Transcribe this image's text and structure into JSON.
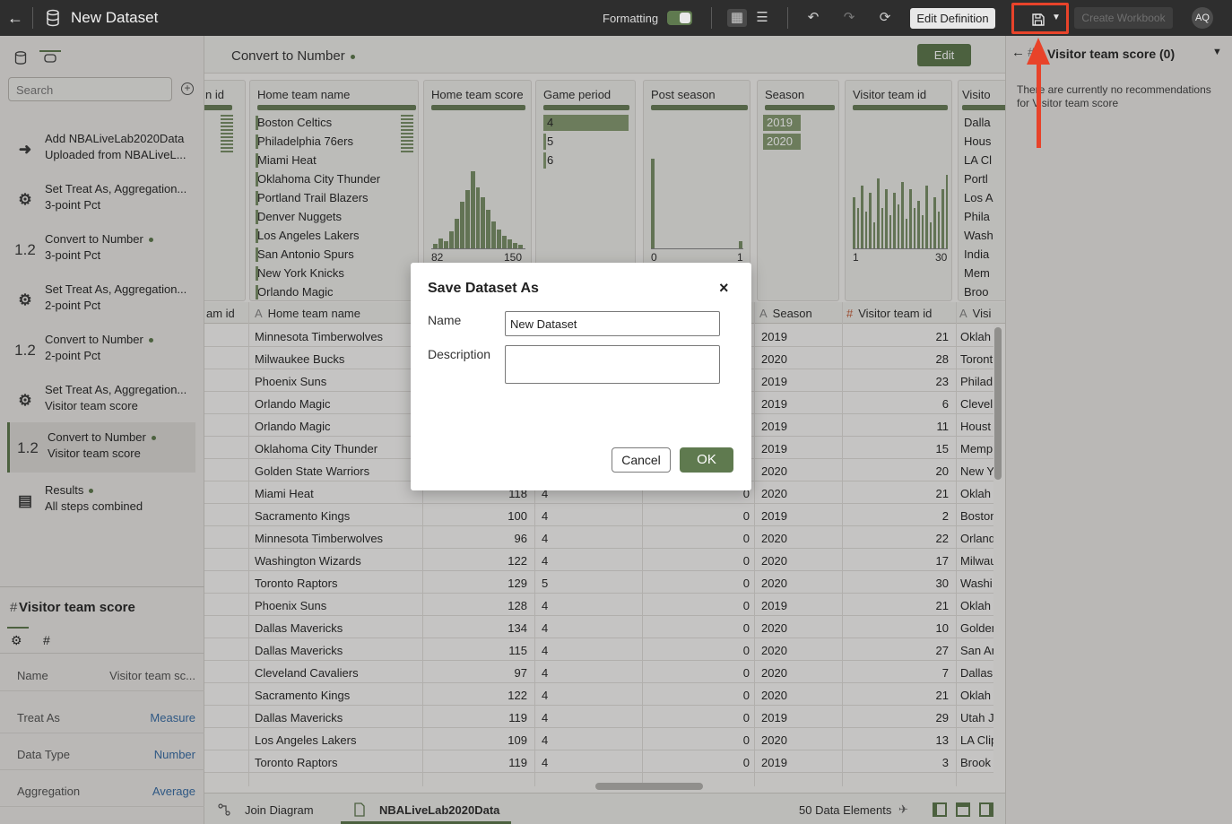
{
  "topbar": {
    "title": "New Dataset",
    "formatting_label": "Formatting",
    "edit_definition": "Edit Definition",
    "create_workbook": "Create Workbook",
    "avatar": "AQ"
  },
  "left_panel": {
    "search_placeholder": "Search",
    "steps": [
      {
        "icon": "arrow-into-icon",
        "line1": "Add NBALiveLab2020Data",
        "line2": "Uploaded from NBALiveL..."
      },
      {
        "icon": "gear-icon",
        "line1": "Set Treat As, Aggregation...",
        "line2": "3-point Pct"
      },
      {
        "icon": "number-icon",
        "icon_text": "1.2",
        "line1": "Convert to Number",
        "line2": "3-point Pct"
      },
      {
        "icon": "gear-icon",
        "line1": "Set Treat As, Aggregation...",
        "line2": "2-point Pct"
      },
      {
        "icon": "number-icon",
        "icon_text": "1.2",
        "line1": "Convert to Number",
        "line2": "2-point Pct"
      },
      {
        "icon": "gear-icon",
        "line1": "Set Treat As, Aggregation...",
        "line2": "Visitor team score"
      },
      {
        "icon": "number-icon",
        "icon_text": "1.2",
        "line1": "Convert to Number",
        "line2": "Visitor team score"
      },
      {
        "icon": "results-icon",
        "line1": "Results",
        "line2": "All steps combined"
      }
    ],
    "column_properties": {
      "hash": "#",
      "title": "Visitor team score",
      "tab_hash": "#",
      "rows": [
        {
          "key": "Name",
          "value": "Visitor team sc..."
        },
        {
          "key": "Treat As",
          "value": "Measure"
        },
        {
          "key": "Data Type",
          "value": "Number"
        },
        {
          "key": "Aggregation",
          "value": "Average"
        }
      ]
    }
  },
  "center": {
    "step_title": "Convert to Number",
    "edit_button": "Edit",
    "cards": {
      "home_team_id": {
        "header": "n id"
      },
      "home_team_name": {
        "header": "Home team name",
        "items": [
          "Boston Celtics",
          "Philadelphia 76ers",
          "Miami Heat",
          "Oklahoma City Thunder",
          "Portland Trail Blazers",
          "Denver Nuggets",
          "Los Angeles Lakers",
          "San Antonio Spurs",
          "New York Knicks",
          "Orlando Magic"
        ]
      },
      "home_team_score": {
        "header": "Home team score",
        "min": "82",
        "max": "150",
        "histogram": [
          0.05,
          0.12,
          0.08,
          0.2,
          0.35,
          0.55,
          0.68,
          0.9,
          0.72,
          0.6,
          0.45,
          0.32,
          0.22,
          0.15,
          0.1,
          0.06,
          0.04
        ]
      },
      "game_period": {
        "header": "Game period",
        "items": [
          "4",
          "5",
          "6"
        ],
        "fills": [
          1.0,
          0.03,
          0.02
        ]
      },
      "post_season": {
        "header": "Post season",
        "min": "0",
        "max": "1",
        "histogram": [
          1.0,
          0.08
        ]
      },
      "season": {
        "header": "Season",
        "items": [
          "2019",
          "2020"
        ]
      },
      "visitor_team_id": {
        "header": "Visitor team id",
        "min": "1",
        "max": "30",
        "histogram": [
          0.7,
          0.55,
          0.85,
          0.5,
          0.75,
          0.35,
          0.95,
          0.55,
          0.8,
          0.45,
          0.75,
          0.6,
          0.9,
          0.4,
          0.8,
          0.55,
          0.65,
          0.45,
          0.85,
          0.35,
          0.7,
          0.5,
          0.8,
          1.0
        ]
      },
      "visitor_team_name": {
        "header": "Visito",
        "items": [
          "Dalla",
          "Hous",
          "LA Cl",
          "Portl",
          "Los A",
          "Phila",
          "Wash",
          "India",
          "Mem",
          "Broo"
        ]
      }
    },
    "grid_headers": {
      "home_team_id": "am id",
      "home_team_name": "Home team name",
      "season": "Season",
      "visitor_team_id": "Visitor team id",
      "visitor_team_name": "Visi"
    },
    "rows": [
      {
        "home": "Minnesota Timberwolves",
        "score": "",
        "period": "",
        "post": "",
        "season": "2019",
        "vid": "21",
        "vname": "Oklah"
      },
      {
        "home": "Milwaukee Bucks",
        "score": "",
        "period": "",
        "post": "",
        "season": "2020",
        "vid": "28",
        "vname": "Toront"
      },
      {
        "home": "Phoenix Suns",
        "score": "",
        "period": "",
        "post": "",
        "season": "2019",
        "vid": "23",
        "vname": "Philad"
      },
      {
        "home": "Orlando Magic",
        "score": "",
        "period": "",
        "post": "",
        "season": "2019",
        "vid": "6",
        "vname": "Clevel"
      },
      {
        "home": "Orlando Magic",
        "score": "",
        "period": "",
        "post": "",
        "season": "2019",
        "vid": "11",
        "vname": "Houst"
      },
      {
        "home": "Oklahoma City Thunder",
        "score": "",
        "period": "",
        "post": "",
        "season": "2019",
        "vid": "15",
        "vname": "Memp"
      },
      {
        "home": "Golden State Warriors",
        "score": "",
        "period": "",
        "post": "",
        "season": "2020",
        "vid": "20",
        "vname": "New Y"
      },
      {
        "home": "Miami Heat",
        "score": "118",
        "period": "4",
        "post": "0",
        "season": "2020",
        "vid": "21",
        "vname": "Oklah"
      },
      {
        "home": "Sacramento Kings",
        "score": "100",
        "period": "4",
        "post": "0",
        "season": "2019",
        "vid": "2",
        "vname": "Boston"
      },
      {
        "home": "Minnesota Timberwolves",
        "score": "96",
        "period": "4",
        "post": "0",
        "season": "2020",
        "vid": "22",
        "vname": "Orland"
      },
      {
        "home": "Washington Wizards",
        "score": "122",
        "period": "4",
        "post": "0",
        "season": "2020",
        "vid": "17",
        "vname": "Milwau"
      },
      {
        "home": "Toronto Raptors",
        "score": "129",
        "period": "5",
        "post": "0",
        "season": "2020",
        "vid": "30",
        "vname": "Washi"
      },
      {
        "home": "Phoenix Suns",
        "score": "128",
        "period": "4",
        "post": "0",
        "season": "2019",
        "vid": "21",
        "vname": "Oklah"
      },
      {
        "home": "Dallas Mavericks",
        "score": "134",
        "period": "4",
        "post": "0",
        "season": "2020",
        "vid": "10",
        "vname": "Golden"
      },
      {
        "home": "Dallas Mavericks",
        "score": "115",
        "period": "4",
        "post": "0",
        "season": "2020",
        "vid": "27",
        "vname": "San An"
      },
      {
        "home": "Cleveland Cavaliers",
        "score": "97",
        "period": "4",
        "post": "0",
        "season": "2020",
        "vid": "7",
        "vname": "Dallas"
      },
      {
        "home": "Sacramento Kings",
        "score": "122",
        "period": "4",
        "post": "0",
        "season": "2020",
        "vid": "21",
        "vname": "Oklah"
      },
      {
        "home": "Dallas Mavericks",
        "score": "119",
        "period": "4",
        "post": "0",
        "season": "2019",
        "vid": "29",
        "vname": "Utah J"
      },
      {
        "home": "Los Angeles Lakers",
        "score": "109",
        "period": "4",
        "post": "0",
        "season": "2020",
        "vid": "13",
        "vname": "LA Clip"
      },
      {
        "home": "Toronto Raptors",
        "score": "119",
        "period": "4",
        "post": "0",
        "season": "2019",
        "vid": "3",
        "vname": "Brook"
      }
    ]
  },
  "bottom": {
    "join_diagram": "Join Diagram",
    "dataset_tab": "NBALiveLab2020Data",
    "data_elements": "50 Data Elements"
  },
  "right_panel": {
    "hash": "#",
    "title": "Visitor team score (0)",
    "message": "There are currently no recommendations for Visitor team score"
  },
  "dialog": {
    "title": "Save Dataset As",
    "close": "×",
    "name_label": "Name",
    "name_value": "New Dataset",
    "description_label": "Description",
    "description_value": "",
    "cancel": "Cancel",
    "ok": "OK"
  },
  "colors": {
    "accent_green": "#5f7a4f",
    "highlight_red": "#e8432a",
    "topbar_bg": "#2e2e2e"
  }
}
